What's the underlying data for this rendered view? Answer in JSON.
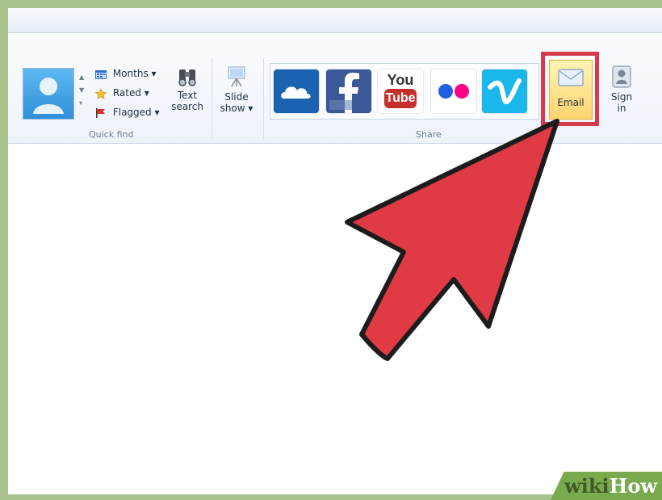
{
  "ribbon": {
    "quick_find": {
      "months_label": "Months ▾",
      "rated_label": "Rated ▾",
      "flagged_label": "Flagged ▾",
      "text_search_line1": "Text",
      "text_search_line2": "search",
      "group_label": "Quick find"
    },
    "slideshow": {
      "line1": "Slide",
      "line2": "show ▾"
    },
    "share": {
      "group_label": "Share",
      "youtube_line1": "You",
      "youtube_line2": "Tube",
      "email_label": "Email"
    },
    "signin": {
      "line1": "Sign",
      "line2": "in"
    }
  },
  "watermark": {
    "wiki": "wiki",
    "how": "How"
  },
  "colors": {
    "highlight_red": "#d63a4b",
    "arrow_red": "#e03a45",
    "wikihow_green": "#7aaa4e"
  },
  "icons": [
    "user-avatar-icon",
    "calendar-icon",
    "star-icon",
    "flag-icon",
    "binoculars-icon",
    "projector-icon",
    "onedrive-cloud-icon",
    "facebook-icon",
    "youtube-icon",
    "flickr-icon",
    "vimeo-icon",
    "email-envelope-icon",
    "person-icon",
    "cursor-arrow-icon"
  ]
}
